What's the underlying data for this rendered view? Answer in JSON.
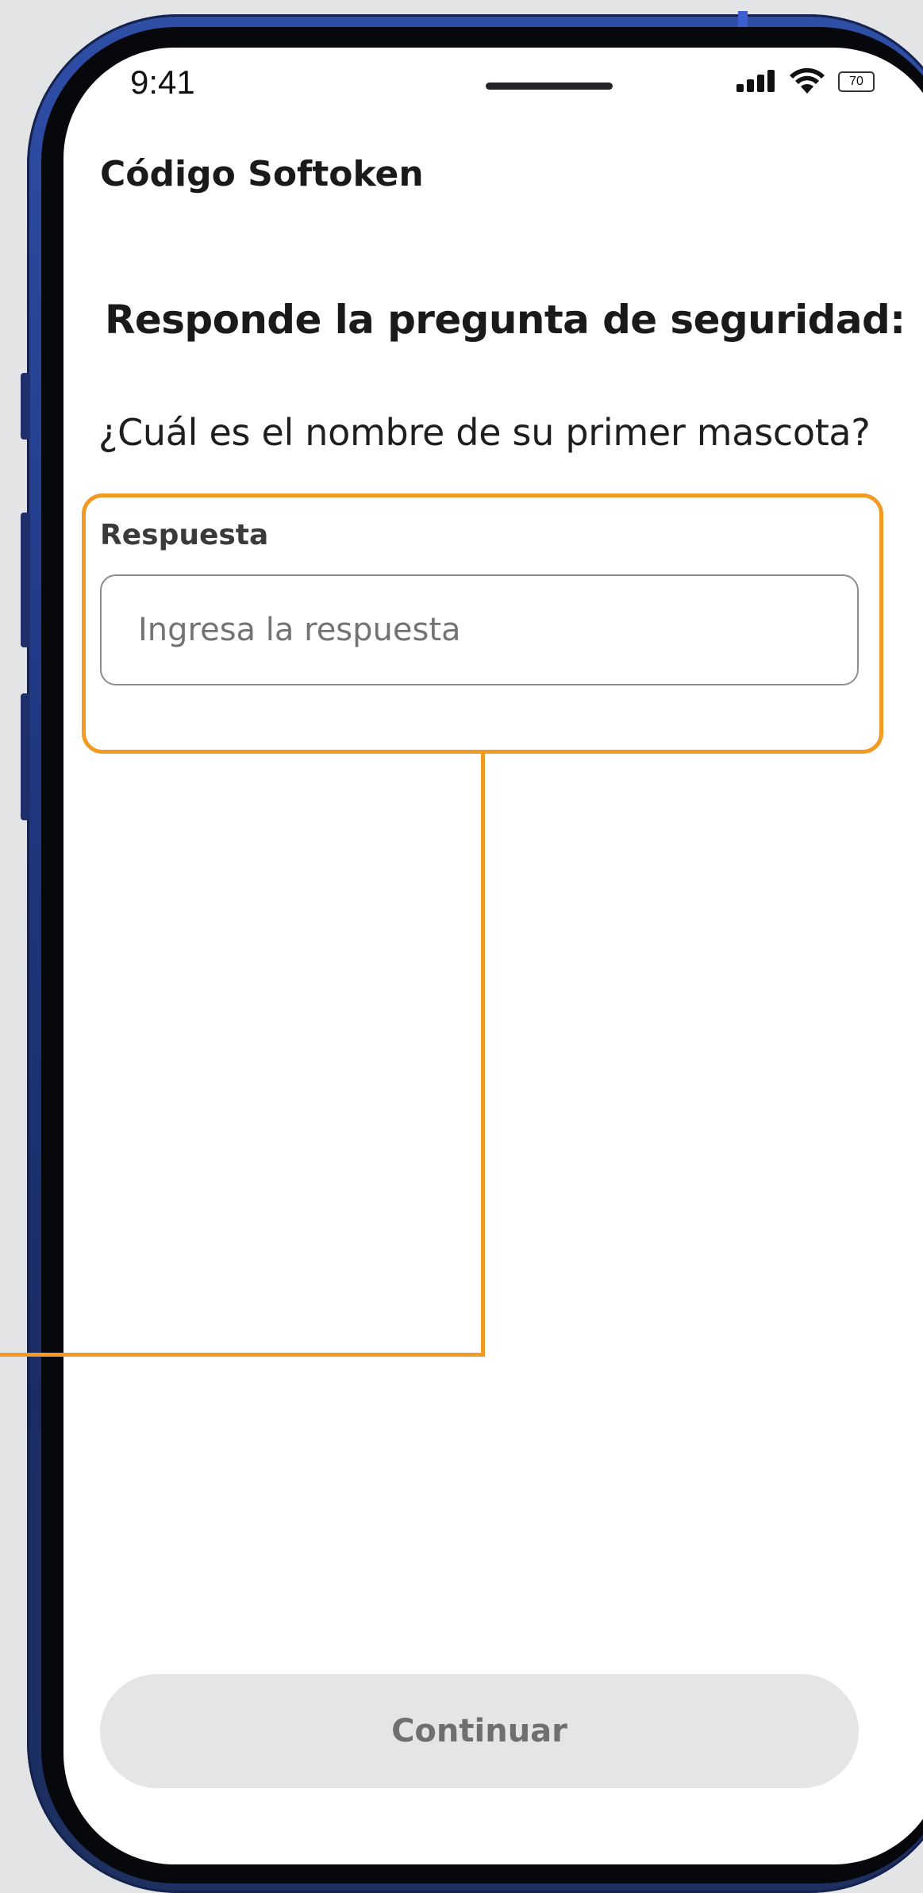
{
  "status_bar": {
    "time": "9:41",
    "battery": "70"
  },
  "header": {
    "title": "Código Softoken"
  },
  "main": {
    "heading": "Responde la pregunta de seguridad:",
    "question": "¿Cuál es el nombre de su primer mascota?",
    "answer_field": {
      "label": "Respuesta",
      "placeholder": "Ingresa la respuesta",
      "value": ""
    },
    "continue_label": "Continuar"
  },
  "colors": {
    "annotation": "#f39a24",
    "phone_frame": "#213a86",
    "button_disabled_bg": "#e4e5e6",
    "button_disabled_text": "#6f6f6f"
  },
  "icons": {
    "signal": "signal-icon",
    "wifi": "wifi-icon",
    "battery": "battery-icon"
  }
}
